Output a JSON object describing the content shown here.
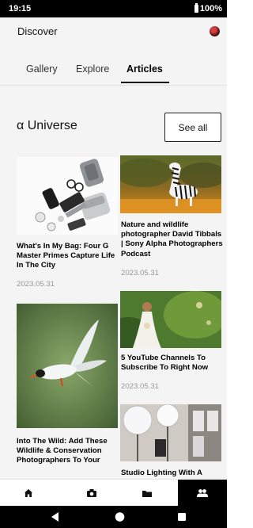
{
  "status": {
    "time": "19:15",
    "battery": "100%"
  },
  "header": {
    "title": "Discover"
  },
  "tabs": [
    {
      "label": "Gallery",
      "active": false
    },
    {
      "label": "Explore",
      "active": false
    },
    {
      "label": "Articles",
      "active": true
    }
  ],
  "section": {
    "title": "α Universe",
    "see_all_label": "See all"
  },
  "articles": [
    {
      "title": "What's In My Bag: Four G Master Primes Capture Life In The City",
      "date": "2023.05.31"
    },
    {
      "title": "Nature and wildlife photographer David Tibbals | Sony Alpha Photographers Podcast",
      "date": "2023.05.31"
    },
    {
      "title": "Into The Wild: Add These Wildlife & Conservation Photographers To Your",
      "date": ""
    },
    {
      "title": "5 YouTube Channels To Subscribe To Right Now",
      "date": "2023.05.31"
    },
    {
      "title": "Studio Lighting With A",
      "date": ""
    }
  ],
  "bottom_nav": [
    {
      "icon": "home-icon",
      "active": false
    },
    {
      "icon": "camera-icon",
      "active": false
    },
    {
      "icon": "folder-icon",
      "active": false
    },
    {
      "icon": "community-icon",
      "active": true
    }
  ],
  "colors": {
    "accent": "#000000",
    "background": "#f4f4f4",
    "date_text": "#999999"
  }
}
